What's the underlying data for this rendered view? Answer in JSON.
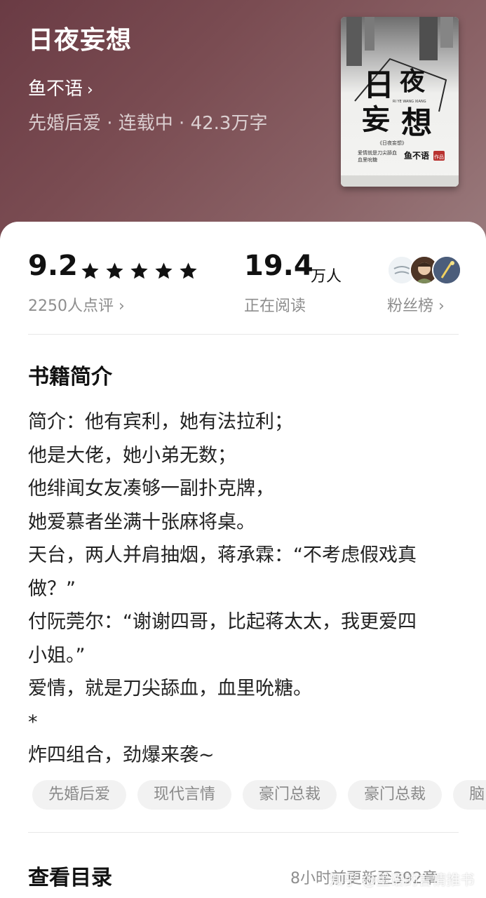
{
  "book": {
    "title": "日夜妄想",
    "author": "鱼不语",
    "author_chevron": "›",
    "meta": "先婚后爱 · 连载中 · 42.3万字"
  },
  "cover": {
    "big_title_1": "日",
    "big_title_2": "夜",
    "big_title_3": "妄",
    "big_title_4": "想",
    "pinyin": "RI YE WANG XIANG",
    "subtitle": "《日夜妄想》",
    "tagline_1": "爱情就是刀尖舔血",
    "tagline_2": "血里吮糖",
    "author_mark": "鱼不语",
    "seal": "作品"
  },
  "stats": {
    "score": "9.2",
    "stars": 5,
    "reviews": "2250人点评 ›",
    "readers": "19.4",
    "readers_unit": "万人",
    "readers_label": "正在阅读",
    "fans_label": "粉丝榜 ›"
  },
  "intro": {
    "title": "书籍简介",
    "lines": [
      "简介：他有宾利，她有法拉利；",
      "他是大佬，她小弟无数；",
      "他绯闻女友凑够一副扑克牌，",
      "她爱慕者坐满十张麻将桌。",
      "天台，两人并肩抽烟，蒋承霖：“不考虑假戏真",
      "做？”",
      "付阮莞尔：“谢谢四哥，比起蒋太太，我更爱四",
      "小姐。”",
      "爱情，就是刀尖舔血，血里吮糖。",
      "*",
      "炸四组合，劲爆来袭~"
    ]
  },
  "tags": [
    "先婚后爱",
    "现代言情",
    "豪门总裁",
    "豪门总裁",
    "脑"
  ],
  "toc": {
    "title": "查看目录",
    "update": "8小时前更新至392章"
  },
  "watermark": "知乎 @墨语的言情推书",
  "colors": {
    "hero_start": "#6a3b44",
    "hero_end": "#9a7b7d",
    "star": "#111111",
    "tag_bg": "#f2f2f2"
  }
}
